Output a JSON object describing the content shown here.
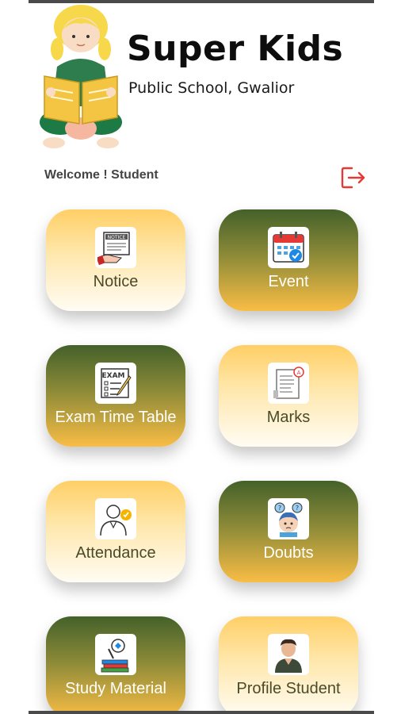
{
  "header": {
    "title": "Super Kids",
    "subtitle": "Public School, Gwalior"
  },
  "welcome": "Welcome ! Student",
  "logout_icon": "logout-icon",
  "colors": {
    "light_top": "#ffcf66",
    "dark_top": "#44612a",
    "gold": "#f9bd45",
    "logout": "#e53935"
  },
  "tiles": [
    {
      "label": "Notice",
      "icon": "notice-icon",
      "style": "light"
    },
    {
      "label": "Event",
      "icon": "calendar-icon",
      "style": "dark"
    },
    {
      "label": "Exam Time Table",
      "icon": "exam-icon",
      "style": "dark"
    },
    {
      "label": "Marks",
      "icon": "marks-icon",
      "style": "light"
    },
    {
      "label": "Attendance",
      "icon": "attendance-icon",
      "style": "light"
    },
    {
      "label": "Doubts",
      "icon": "doubts-icon",
      "style": "dark"
    },
    {
      "label": "Study Material",
      "icon": "study-material-icon",
      "style": "dark"
    },
    {
      "label": "Profile Student",
      "icon": "profile-icon",
      "style": "light"
    }
  ]
}
